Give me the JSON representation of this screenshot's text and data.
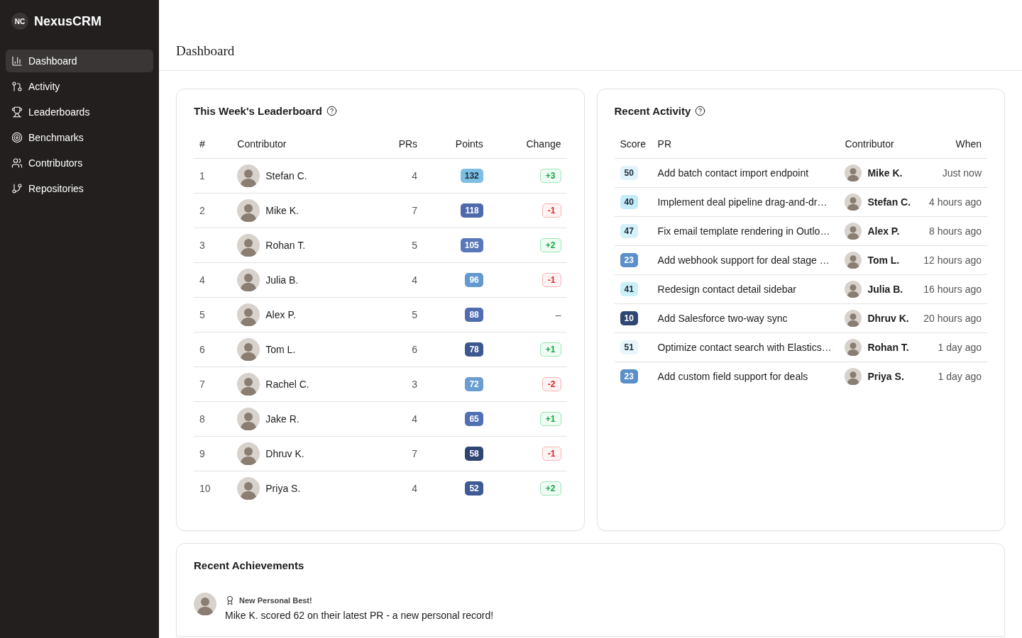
{
  "brand": {
    "initials": "NC",
    "name": "NexusCRM"
  },
  "sidebar": {
    "items": [
      {
        "label": "Dashboard",
        "kind": "chart",
        "selected": true
      },
      {
        "label": "Activity",
        "kind": "pull",
        "selected": false
      },
      {
        "label": "Leaderboards",
        "kind": "trophy",
        "selected": false
      },
      {
        "label": "Benchmarks",
        "kind": "target",
        "selected": false
      },
      {
        "label": "Contributors",
        "kind": "users",
        "selected": false
      },
      {
        "label": "Repositories",
        "kind": "branch",
        "selected": false
      }
    ]
  },
  "page_title": "Dashboard",
  "leaderboard": {
    "title": "This Week's Leaderboard",
    "columns": [
      "#",
      "Contributor",
      "PRs",
      "Points",
      "Change"
    ],
    "rows": [
      {
        "rank": "1",
        "name": "Stefan C.",
        "prs": "4",
        "points": "132",
        "color": "#7dbfe3",
        "change": "+3",
        "kind": "up"
      },
      {
        "rank": "2",
        "name": "Mike K.",
        "prs": "7",
        "points": "118",
        "color": "#4e69ae",
        "change": "-1",
        "kind": "down"
      },
      {
        "rank": "3",
        "name": "Rohan T.",
        "prs": "5",
        "points": "105",
        "color": "#5a78b8",
        "change": "+2",
        "kind": "up"
      },
      {
        "rank": "4",
        "name": "Julia B.",
        "prs": "4",
        "points": "96",
        "color": "#6199d0",
        "change": "-1",
        "kind": "down"
      },
      {
        "rank": "5",
        "name": "Alex P.",
        "prs": "5",
        "points": "88",
        "color": "#4f6db0",
        "change": "–",
        "kind": "none"
      },
      {
        "rank": "6",
        "name": "Tom L.",
        "prs": "6",
        "points": "78",
        "color": "#3d5890",
        "change": "+1",
        "kind": "up"
      },
      {
        "rank": "7",
        "name": "Rachel C.",
        "prs": "3",
        "points": "72",
        "color": "#6a9dd0",
        "change": "-2",
        "kind": "down"
      },
      {
        "rank": "8",
        "name": "Jake R.",
        "prs": "4",
        "points": "65",
        "color": "#5070b3",
        "change": "+1",
        "kind": "up"
      },
      {
        "rank": "9",
        "name": "Dhruv K.",
        "prs": "7",
        "points": "58",
        "color": "#2f4673",
        "change": "-1",
        "kind": "down"
      },
      {
        "rank": "10",
        "name": "Priya S.",
        "prs": "4",
        "points": "52",
        "color": "#3d5a94",
        "change": "+2",
        "kind": "up"
      }
    ]
  },
  "activity": {
    "title": "Recent Activity",
    "columns": [
      "Score",
      "PR",
      "Contributor",
      "When"
    ],
    "rows": [
      {
        "score": "50",
        "color": "#e0f4fb",
        "pr": "Add batch contact import endpoint",
        "name": "Mike K.",
        "when": "Just now"
      },
      {
        "score": "40",
        "color": "#c4ecf8",
        "pr": "Implement deal pipeline drag-and-dr…",
        "name": "Stefan C.",
        "when": "4 hours ago"
      },
      {
        "score": "47",
        "color": "#d4f1fa",
        "pr": "Fix email template rendering in Outlo…",
        "name": "Alex P.",
        "when": "8 hours ago"
      },
      {
        "score": "23",
        "color": "#5b8fc9",
        "pr": "Add webhook support for deal stage …",
        "name": "Tom L.",
        "when": "12 hours ago"
      },
      {
        "score": "41",
        "color": "#caf0f8",
        "pr": "Redesign contact detail sidebar",
        "name": "Julia B.",
        "when": "16 hours ago"
      },
      {
        "score": "10",
        "color": "#2f4673",
        "pr": "Add Salesforce two-way sync",
        "name": "Dhruv K.",
        "when": "20 hours ago"
      },
      {
        "score": "51",
        "color": "#e6f6fb",
        "pr": "Optimize contact search with Elastics…",
        "name": "Rohan T.",
        "when": "1 day ago"
      },
      {
        "score": "23",
        "color": "#5b8fc9",
        "pr": "Add custom field support for deals",
        "name": "Priya S.",
        "when": "1 day ago"
      }
    ]
  },
  "achievements": {
    "title": "Recent Achievements",
    "items": [
      {
        "label": "New Personal Best!",
        "text": "Mike K. scored 62 on their latest PR - a new personal record!"
      }
    ]
  }
}
